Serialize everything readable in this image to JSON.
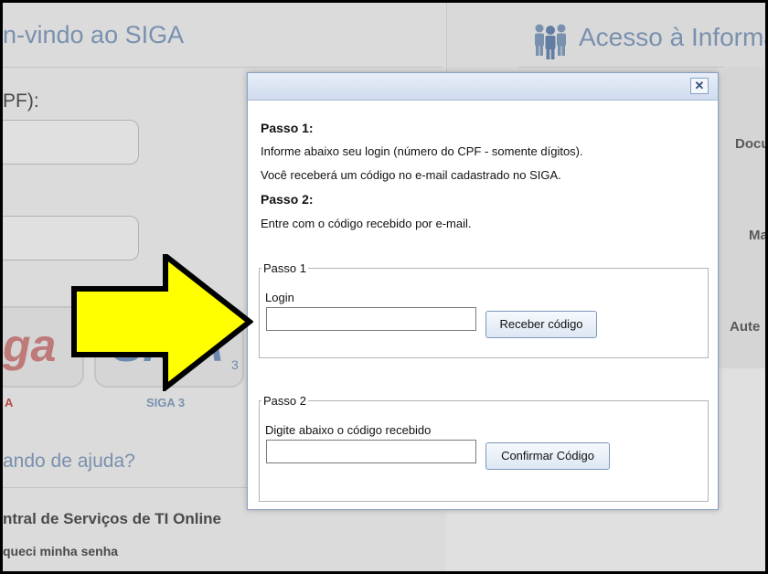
{
  "background": {
    "welcome_title": "n-vindo ao SIGA",
    "cpf_label": "PF):",
    "siga_logo_text": "ga",
    "siga3_logo_text": "SIGA",
    "siga3_logo_sub": "3",
    "caption_a": "A",
    "caption_siga3": "SIGA 3",
    "help_title": "ando de ajuda?",
    "central_link": "ntral de Serviços de TI Online",
    "forgot_link": "queci minha senha",
    "acesso_title": "Acesso à Informa",
    "side_items": [
      "Docu",
      "Ma",
      "Aute"
    ]
  },
  "dialog": {
    "close_label": "✕",
    "step1_heading": "Passo 1:",
    "step1_line1": "Informe abaixo seu login (número do CPF - somente dígitos).",
    "step1_line2": "Você receberá um código no e-mail cadastrado no SIGA.",
    "step2_heading": "Passo 2:",
    "step2_line1": "Entre com o código recebido por e-mail.",
    "fieldset1": {
      "legend": "Passo 1",
      "label": "Login",
      "input_value": "",
      "button_label": "Receber código"
    },
    "fieldset2": {
      "legend": "Passo 2",
      "label": "Digite abaixo o código recebido",
      "input_value": "",
      "button_label": "Confirmar Código"
    }
  },
  "icons": {
    "close": "close-icon",
    "people": "people-group-icon",
    "arrow": "arrow-right-icon"
  },
  "colors": {
    "accent_blue": "#8aa5c7",
    "arrow_fill": "#ffff00",
    "dialog_border": "#8aa2c2"
  }
}
